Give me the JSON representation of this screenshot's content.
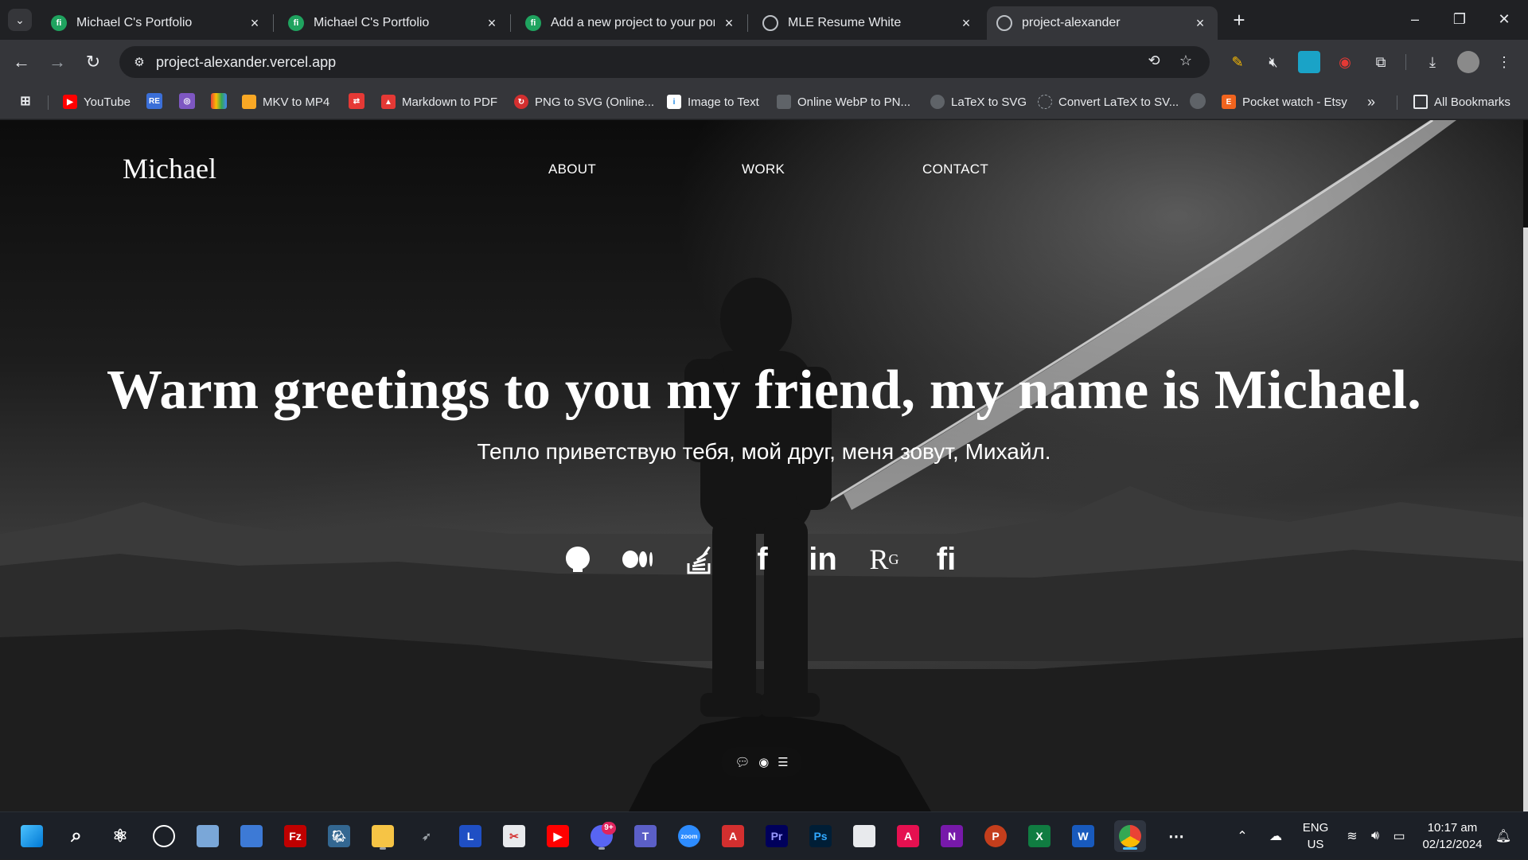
{
  "browser": {
    "tabs": [
      {
        "title": "Michael C's Portfolio",
        "favicon": "fi-green-icon",
        "active": false
      },
      {
        "title": "Michael C's Portfolio",
        "favicon": "fi-green-icon",
        "active": false
      },
      {
        "title": "Add a new project to your portf",
        "favicon": "fi-green-icon",
        "active": false
      },
      {
        "title": "MLE Resume White",
        "favicon": "globe-icon",
        "active": false
      },
      {
        "title": "project-alexander",
        "favicon": "globe-icon",
        "active": true
      }
    ],
    "url": "project-alexander.vercel.app",
    "bookmarks": [
      {
        "label": "YouTube",
        "icon": "youtube-icon",
        "color": "#ff0000"
      },
      {
        "label": "",
        "icon": "repo-icon",
        "color": "#3b6fd8"
      },
      {
        "label": "",
        "icon": "podcast-icon",
        "color": "#7e57c2"
      },
      {
        "label": "",
        "icon": "color-grid-icon",
        "color": "#fbbc04"
      },
      {
        "label": "MKV to MP4",
        "icon": "converter-icon",
        "color": "#f9a825"
      },
      {
        "label": "",
        "icon": "swap-icon",
        "color": "#e53935"
      },
      {
        "label": "Markdown to PDF",
        "icon": "flame-icon",
        "color": "#e53935"
      },
      {
        "label": "PNG to SVG (Online...",
        "icon": "refresh-red-icon",
        "color": "#d32f2f"
      },
      {
        "label": "Image to Text",
        "icon": "image-text-icon",
        "color": "#1e88e5"
      },
      {
        "label": "Online WebP to PN...",
        "icon": "webp-icon",
        "color": "#5f6368"
      },
      {
        "label": "LaTeX to SVG",
        "icon": "globe-icon",
        "color": "#5f6368"
      },
      {
        "label": "Convert LaTeX to SV...",
        "icon": "dotted-circle-icon",
        "color": "#5f6368"
      },
      {
        "label": "",
        "icon": "globe-icon",
        "color": "#5f6368"
      },
      {
        "label": "Pocket watch - Etsy",
        "icon": "etsy-icon",
        "color": "#f1641e"
      }
    ],
    "all_bookmarks_label": "All Bookmarks"
  },
  "page": {
    "logo": "Michael",
    "nav": [
      "ABOUT",
      "WORK",
      "CONTACT"
    ],
    "headline": "Warm greetings to you my friend, my name is Michael.",
    "subline": "Тепло приветствую тебя, мой друг, меня зовут, Михайл.",
    "social": [
      "github-icon",
      "medium-icon",
      "stackoverflow-icon",
      "facebook-icon",
      "linkedin-icon",
      "researchgate-icon",
      "fi-icon"
    ],
    "researchgate_text": "R",
    "researchgate_sup": "G"
  },
  "taskbar": {
    "language": "ENG",
    "region": "US",
    "time": "10:17 am",
    "date": "02/12/2024",
    "discord_badge": "9+"
  }
}
